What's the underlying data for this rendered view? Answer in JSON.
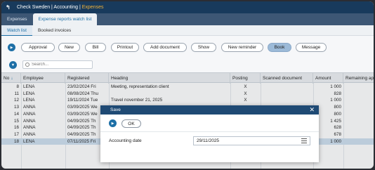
{
  "titlebar": {
    "back_icon": "back-arrow-icon",
    "app_prefix": "Check Sweden | Accounting | ",
    "app_section": "Expenses"
  },
  "tabs": [
    {
      "label": "Expenses"
    },
    {
      "label": "Expense reports watch list"
    }
  ],
  "subtabs": [
    {
      "label": "Watch list"
    },
    {
      "label": "Booked invoices"
    }
  ],
  "toolbar": {
    "buttons": [
      "Approval",
      "New",
      "Bill",
      "Printout",
      "Add document",
      "Show",
      "New reminder",
      "Book",
      "Message"
    ]
  },
  "search": {
    "placeholder": "Search..."
  },
  "table": {
    "headers": [
      "No",
      "Employee",
      "Registered",
      "Heading",
      "Posting",
      "Scanned document",
      "Amount",
      "Remaining app"
    ],
    "rows": [
      {
        "no": "8",
        "employee": "LENA",
        "registered": "23/02/2024 Fri",
        "heading": "Meeting, representation client",
        "posting": "X",
        "scanned": "",
        "amount": "1 000"
      },
      {
        "no": "11",
        "employee": "LENA",
        "registered": "08/08/2024 Thu",
        "heading": "",
        "posting": "X",
        "scanned": "",
        "amount": "828"
      },
      {
        "no": "12",
        "employee": "LENA",
        "registered": "19/11/2024 Tue",
        "heading": "Travel november 21, 2025",
        "posting": "X",
        "scanned": "",
        "amount": "1 000"
      },
      {
        "no": "13",
        "employee": "ANNA",
        "registered": "03/09/2025 We",
        "heading": "",
        "posting": "",
        "scanned": "",
        "amount": "800"
      },
      {
        "no": "14",
        "employee": "ANNA",
        "registered": "03/09/2025 We",
        "heading": "",
        "posting": "",
        "scanned": "",
        "amount": "800"
      },
      {
        "no": "15",
        "employee": "ANNA",
        "registered": "04/09/2025 Th",
        "heading": "",
        "posting": "",
        "scanned": "",
        "amount": "1 425"
      },
      {
        "no": "16",
        "employee": "ANNA",
        "registered": "04/09/2025 Th",
        "heading": "",
        "posting": "",
        "scanned": "",
        "amount": "628"
      },
      {
        "no": "17",
        "employee": "ANNA",
        "registered": "04/09/2025 Th",
        "heading": "",
        "posting": "",
        "scanned": "",
        "amount": "678"
      },
      {
        "no": "18",
        "employee": "LENA",
        "registered": "07/11/2025 Fri",
        "heading": "",
        "posting": "",
        "scanned": "",
        "amount": "1 000"
      }
    ]
  },
  "dialog": {
    "title": "Save",
    "ok_label": "OK",
    "field_label": "Accounting date",
    "field_value": "29/11/2025"
  },
  "colors": {
    "titlebar": "#183a5c",
    "accent": "#1d6fa6",
    "section": "#f0b23a",
    "selected_row": "#cfe0f0"
  }
}
